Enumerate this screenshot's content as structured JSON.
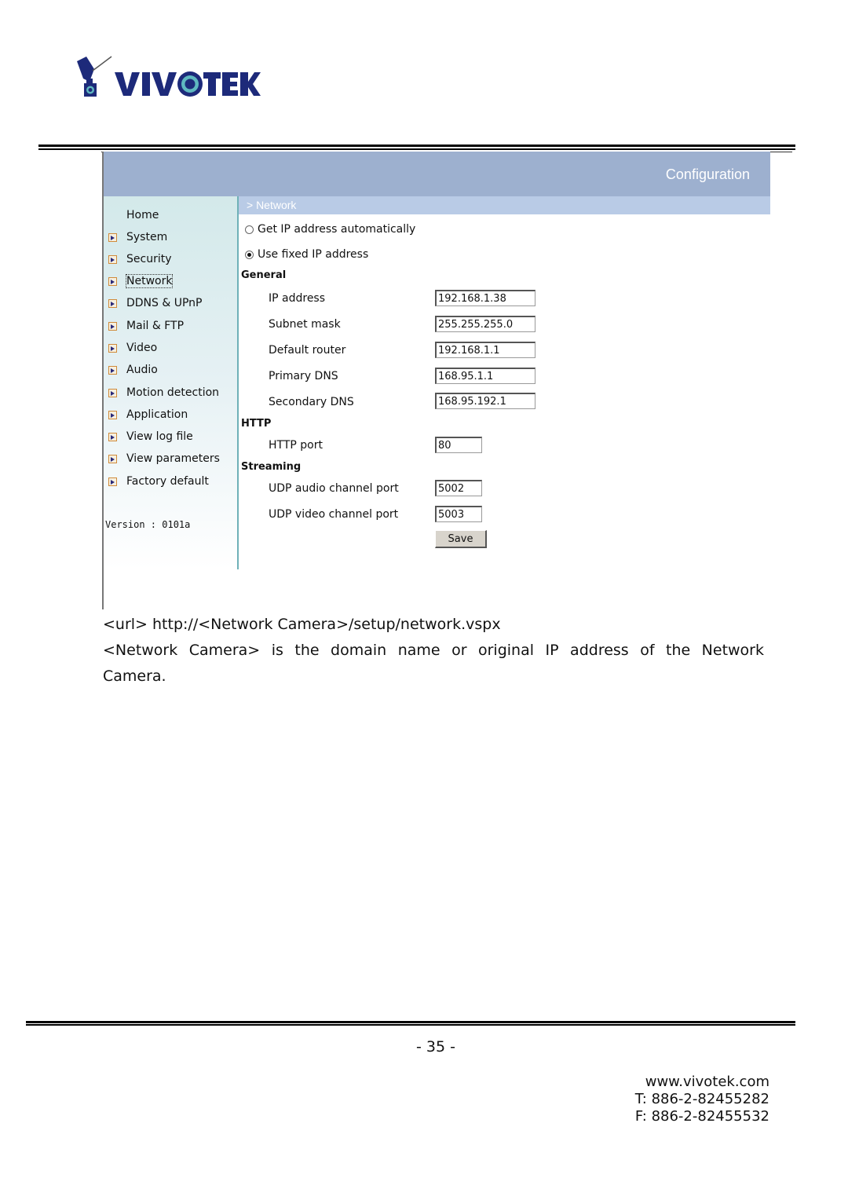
{
  "brand": {
    "name": "VIVOTEK",
    "logo_icon": "vivotek-camera-logo",
    "color_primary": "#1d2a7a",
    "color_accent": "#5fb8c0"
  },
  "screenshot": {
    "header_title": "Configuration",
    "breadcrumb": "> Network",
    "sidebar": {
      "items": [
        {
          "label": "Home",
          "icon": "none"
        },
        {
          "label": "System",
          "icon": "arrow-right-icon"
        },
        {
          "label": "Security",
          "icon": "arrow-right-icon"
        },
        {
          "label": "Network",
          "icon": "arrow-right-icon",
          "focused": true
        },
        {
          "label": "DDNS & UPnP",
          "icon": "arrow-right-icon"
        },
        {
          "label": "Mail & FTP",
          "icon": "arrow-right-icon"
        },
        {
          "label": "Video",
          "icon": "arrow-right-icon"
        },
        {
          "label": "Audio",
          "icon": "arrow-right-icon"
        },
        {
          "label": "Motion detection",
          "icon": "arrow-right-icon"
        },
        {
          "label": "Application",
          "icon": "arrow-right-icon"
        },
        {
          "label": "View log file",
          "icon": "arrow-right-icon"
        },
        {
          "label": "View parameters",
          "icon": "arrow-right-icon"
        },
        {
          "label": "Factory default",
          "icon": "arrow-right-icon"
        }
      ],
      "version": "Version : 0101a"
    },
    "ip_mode": {
      "options": [
        {
          "label": "Get IP address automatically",
          "checked": false
        },
        {
          "label": "Use fixed IP address",
          "checked": true
        }
      ]
    },
    "sections": {
      "general": {
        "title": "General",
        "fields": [
          {
            "label": "IP address",
            "value": "192.168.1.38"
          },
          {
            "label": "Subnet mask",
            "value": "255.255.255.0"
          },
          {
            "label": "Default router",
            "value": "192.168.1.1"
          },
          {
            "label": "Primary DNS",
            "value": "168.95.1.1"
          },
          {
            "label": "Secondary DNS",
            "value": "168.95.192.1"
          }
        ]
      },
      "http": {
        "title": "HTTP",
        "fields": [
          {
            "label": "HTTP port",
            "value": "80"
          }
        ]
      },
      "streaming": {
        "title": "Streaming",
        "fields": [
          {
            "label": "UDP audio channel port",
            "value": "5002"
          },
          {
            "label": "UDP video channel port",
            "value": "5003"
          }
        ]
      }
    },
    "save_label": "Save",
    "colors": {
      "header_band": "#9db0cf",
      "subheader_band": "#b9cbe6",
      "sidebar_bg": "#d3e9ea",
      "sidebar_divider": "#6fb1b8"
    }
  },
  "body_text": {
    "url_line": "<url> http://<Network Camera>/setup/network.vspx",
    "desc_line1": "<Network Camera> is the domain name or original IP address of the Network",
    "desc_line2": "Camera."
  },
  "footer": {
    "page_number": "- 35 -",
    "website": "www.vivotek.com",
    "phone": "T: 886-2-82455282",
    "fax": "F: 886-2-82455532"
  }
}
